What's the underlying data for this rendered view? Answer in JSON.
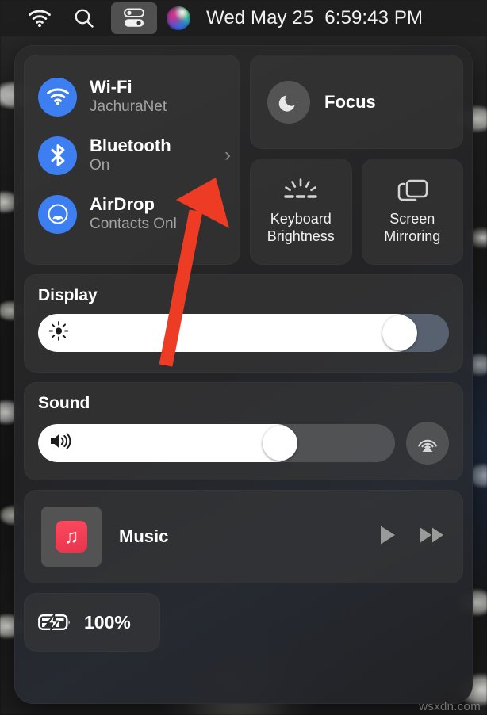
{
  "menubar": {
    "wifi_icon": "wifi-icon",
    "search_icon": "search-icon",
    "control_center_icon": "control-center-icon",
    "siri_icon": "siri-icon",
    "date": "Wed May 25",
    "time": "6:59:43 PM"
  },
  "control_center": {
    "connectivity": [
      {
        "name": "Wi-Fi",
        "status": "JachuraNet",
        "icon": "wifi-icon",
        "has_chevron": false
      },
      {
        "name": "Bluetooth",
        "status": "On",
        "icon": "bluetooth-icon",
        "has_chevron": true
      },
      {
        "name": "AirDrop",
        "status": "Contacts Onl",
        "icon": "airdrop-icon",
        "has_chevron": false
      }
    ],
    "focus": {
      "label": "Focus",
      "icon": "moon-icon"
    },
    "tiles": [
      {
        "label": "Keyboard Brightness",
        "icon": "keyboard-brightness-icon"
      },
      {
        "label": "Screen Mirroring",
        "icon": "screen-mirroring-icon"
      }
    ],
    "display": {
      "title": "Display",
      "icon": "brightness-icon",
      "value": 92
    },
    "sound": {
      "title": "Sound",
      "icon": "speaker-icon",
      "value": 70,
      "airplay_icon": "airplay-audio-icon"
    },
    "music": {
      "title": "Music",
      "app_icon": "music-app-icon",
      "play_icon": "play-icon",
      "next_icon": "fast-forward-icon"
    },
    "battery": {
      "percent": "100%",
      "icon": "battery-charging-icon"
    }
  },
  "annotation": {
    "type": "arrow",
    "color": "#ee3b23",
    "points_to": "bluetooth-chevron"
  },
  "watermark": {
    "text": "wsxdn.com"
  },
  "colors": {
    "accent_blue": "#3d7ff0",
    "music_red": "#e8344d",
    "annotation_red": "#ee3b23",
    "panel_bg": "#2a2a2a",
    "card_bg": "#3a3a3a",
    "text_primary": "#ffffff",
    "text_secondary": "#a3a3a3"
  }
}
